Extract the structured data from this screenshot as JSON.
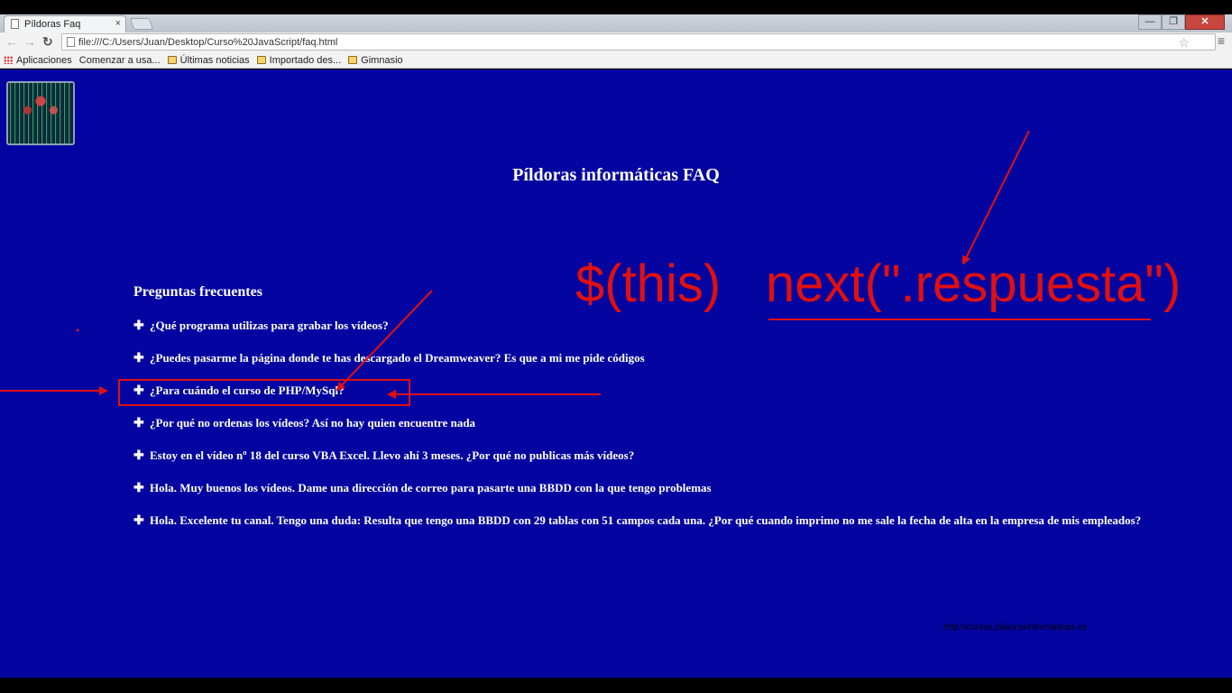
{
  "browser": {
    "tab_title": "Píldoras Faq",
    "tab_close": "×",
    "url": "file:///C:/Users/Juan/Desktop/Curso%20JavaScript/faq.html",
    "bookmarks": [
      {
        "label": "Aplicaciones",
        "icon": "apps-icon"
      },
      {
        "label": "Comenzar a usa...",
        "icon": "page-icon"
      },
      {
        "label": "Últimas noticias",
        "icon": "folder-icon"
      },
      {
        "label": "Importado des...",
        "icon": "folder-icon"
      },
      {
        "label": "Gimnasio",
        "icon": "folder-icon"
      }
    ]
  },
  "page": {
    "title": "Píldoras informáticas FAQ",
    "faq_heading": "Preguntas frecuentes",
    "faq_items": [
      "¿Qué programa utilizas para grabar los vídeos?",
      "¿Puedes pasarme la página donde te has descargado el Dreamweaver? Es que a mi me pide códigos",
      "¿Para cuándo el curso de PHP/MySql?",
      "¿Por qué no ordenas los vídeos? Así no hay quien encuentre nada",
      "Estoy en el vídeo nº 18 del curso VBA Excel. Llevo ahí 3 meses. ¿Por qué no publicas más vídeos?",
      "Hola. Muy buenos los vídeos. Dame una dirección de correo para pasarte una BBDD con la que tengo problemas",
      "Hola. Excelente tu canal. Tengo una duda: Resulta que tengo una BBDD con 29 tablas con 51 campos cada una. ¿Por qué cuando imprimo no me sale la fecha de alta en la empresa de mis empleados?"
    ],
    "plus_symbol": "✚",
    "footer_link": "http://cursos.pildorasinformaticas.es"
  },
  "annotation": {
    "text_this": "$(this)",
    "text_next": "next(\".respuesta\")",
    "color": "#e01010"
  }
}
